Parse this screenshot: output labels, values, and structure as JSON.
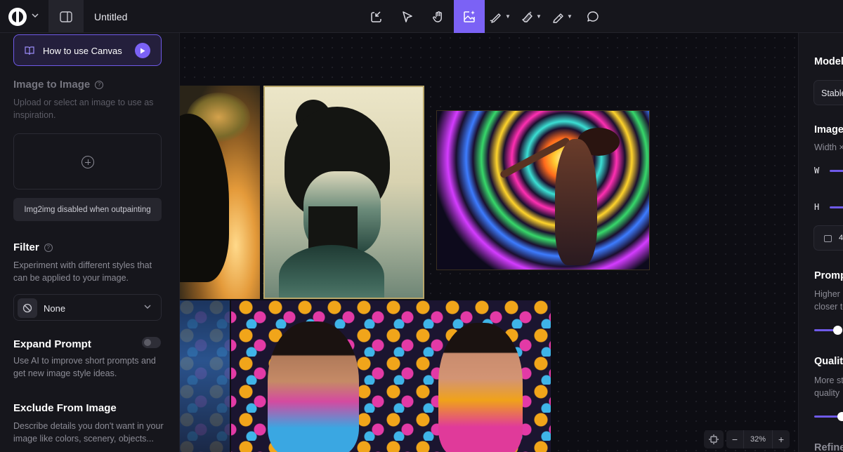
{
  "header": {
    "title": "Untitled",
    "tools": [
      {
        "name": "import",
        "icon": "import-icon"
      },
      {
        "name": "select",
        "icon": "pointer-icon"
      },
      {
        "name": "pan",
        "icon": "hand-icon"
      },
      {
        "name": "generate",
        "icon": "image-sparkle-icon",
        "active": true
      },
      {
        "name": "sketch",
        "icon": "pen-icon"
      },
      {
        "name": "erase",
        "icon": "eraser-icon"
      },
      {
        "name": "draw",
        "icon": "pencil-icon"
      },
      {
        "name": "comment",
        "icon": "comment-icon"
      }
    ]
  },
  "sidebar": {
    "howto_label": "How to use Canvas",
    "img2img": {
      "title": "Image to Image",
      "desc": "Upload or select an image to use as inspiration.",
      "disabled_note": "Img2img disabled when outpainting"
    },
    "filter": {
      "title": "Filter",
      "desc": "Experiment with different styles that can be applied to your image.",
      "value": "None"
    },
    "expand_prompt": {
      "title": "Expand Prompt",
      "desc": "Use AI to improve short prompts and get new image style ideas.",
      "enabled": false
    },
    "exclude": {
      "title": "Exclude From Image",
      "desc": "Describe details you don't want in your image like colors, scenery, objects..."
    }
  },
  "canvas": {
    "zoom": "32%",
    "zoom_out": "−",
    "zoom_in": "+"
  },
  "rpanel": {
    "model_title": "Model",
    "model_value": "Stable",
    "image_title": "Image",
    "image_desc": "Width ×",
    "w_label": "W",
    "h_label": "H",
    "count": "4",
    "prompt_title": "Prompt",
    "prompt_desc_1": "Higher",
    "prompt_desc_2": "closer to",
    "quality_title": "Quality",
    "quality_desc_1": "More st",
    "quality_desc_2": "quality",
    "refine_title": "Refine"
  },
  "colors": {
    "accent": "#7b62f5",
    "panel": "#16161c",
    "canvas": "#0d0d13"
  }
}
